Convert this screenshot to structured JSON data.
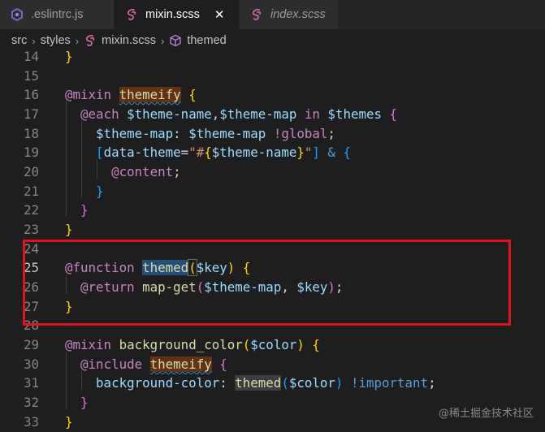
{
  "tabs": [
    {
      "label": ".eslintrc.js",
      "icon": "eslint-icon",
      "active": false,
      "italic": false
    },
    {
      "label": "mixin.scss",
      "icon": "sass-icon",
      "active": true,
      "italic": false,
      "close": "✕"
    },
    {
      "label": "index.scss",
      "icon": "sass-icon",
      "active": false,
      "italic": true
    }
  ],
  "breadcrumb": {
    "items": [
      "src",
      "styles",
      "mixin.scss",
      "themed"
    ],
    "separator": "›"
  },
  "colors": {
    "keyword": "#c586c0",
    "function": "#dcdcaa",
    "variable": "#9cdcfe",
    "string": "#ce9178",
    "highlight_box": "#e0141e",
    "sass_icon": "#cd6799"
  },
  "lines": [
    {
      "n": "14",
      "t": "}"
    },
    {
      "n": "15",
      "t": ""
    },
    {
      "n": "16",
      "t": "@mixin themeify {"
    },
    {
      "n": "17",
      "t": "  @each $theme-name,$theme-map in $themes {"
    },
    {
      "n": "18",
      "t": "    $theme-map: $theme-map !global;"
    },
    {
      "n": "19",
      "t": "    [data-theme=\"#{$theme-name}\"] & {"
    },
    {
      "n": "20",
      "t": "      @content;"
    },
    {
      "n": "21",
      "t": "    }"
    },
    {
      "n": "22",
      "t": "  }"
    },
    {
      "n": "23",
      "t": "}"
    },
    {
      "n": "24",
      "t": ""
    },
    {
      "n": "25",
      "t": "@function themed($key) {"
    },
    {
      "n": "26",
      "t": "  @return map-get($theme-map, $key);"
    },
    {
      "n": "27",
      "t": "}"
    },
    {
      "n": "28",
      "t": ""
    },
    {
      "n": "29",
      "t": "@mixin background_color($color) {"
    },
    {
      "n": "30",
      "t": "  @include themeify {"
    },
    {
      "n": "31",
      "t": "    background-color: themed($color) !important;"
    },
    {
      "n": "32",
      "t": "  }"
    },
    {
      "n": "33",
      "t": "}"
    }
  ],
  "watermark": "@稀土掘金技术社区"
}
